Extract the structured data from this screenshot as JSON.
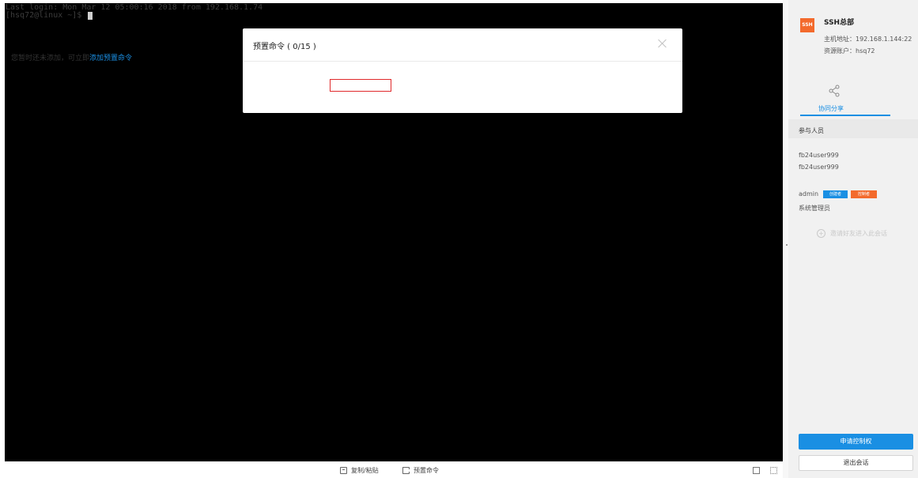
{
  "terminal": {
    "lines": [
      "Last login: Mon Mar 12 05:00:16 2018 from 192.168.1.74",
      "[hsq72@linux ~]$ "
    ]
  },
  "modal": {
    "title": "预置命令 ( 0/15 )",
    "body_text": "您暂时还未添加，可立即",
    "link_text": "添加预置命令"
  },
  "toolbar": {
    "copy_paste_label": "复制/粘贴",
    "preset_command_label": "预置命令",
    "copy_icon": "copy-icon",
    "command_icon": "command-icon",
    "window_icon": "window-icon",
    "fullscreen_icon": "fullscreen-icon"
  },
  "sidebar": {
    "badge": "SSH",
    "title": "SSH总部",
    "host_address": "主机地址：192.168.1.144:22",
    "resource_account": "资源账户：hsq72",
    "share_tab_label": "协同分享",
    "participants_label": "参与人员",
    "users": [
      "fb24user999",
      "fb24user999"
    ],
    "admin": {
      "name": "admin",
      "tags": [
        "创建者",
        "控制者"
      ],
      "role": "系统管理员"
    },
    "invite_label": "邀请好友进入此会话",
    "request_control_button": "申请控制权",
    "exit_session_button": "退出会话"
  },
  "colors": {
    "accent": "#1a8fe3",
    "orange": "#f36a2c",
    "highlight": "#e0292b"
  }
}
